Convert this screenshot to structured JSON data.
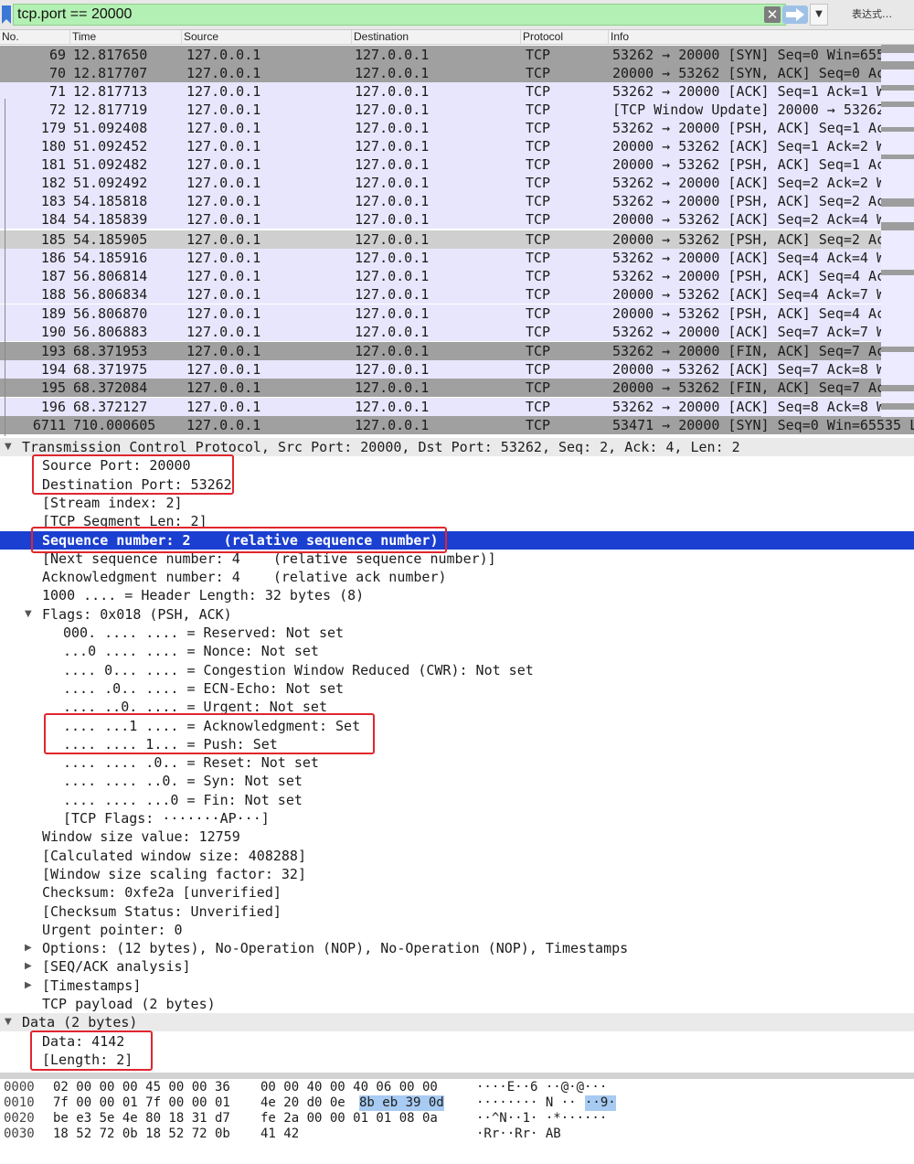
{
  "filter": {
    "value": "tcp.port == 20000",
    "expression_button": "表达式…",
    "input_color": "#b3f0b3"
  },
  "columns": [
    "No.",
    "Time",
    "Source",
    "Destination",
    "Protocol",
    "Info"
  ],
  "packets": [
    {
      "no": "69",
      "time": "12.817650",
      "src": "127.0.0.1",
      "dst": "127.0.0.1",
      "proto": "TCP",
      "info": "53262 → 20000 [SYN] Seq=0 Win=6553",
      "style": "dark"
    },
    {
      "no": "70",
      "time": "12.817707",
      "src": "127.0.0.1",
      "dst": "127.0.0.1",
      "proto": "TCP",
      "info": "20000 → 53262 [SYN, ACK] Seq=0 Ack",
      "style": "dark"
    },
    {
      "no": "71",
      "time": "12.817713",
      "src": "127.0.0.1",
      "dst": "127.0.0.1",
      "proto": "TCP",
      "info": "53262 → 20000 [ACK] Seq=1 Ack=1 Wi",
      "style": "normal"
    },
    {
      "no": "72",
      "time": "12.817719",
      "src": "127.0.0.1",
      "dst": "127.0.0.1",
      "proto": "TCP",
      "info": "[TCP Window Update] 20000 → 53262",
      "style": "normal"
    },
    {
      "no": "179",
      "time": "51.092408",
      "src": "127.0.0.1",
      "dst": "127.0.0.1",
      "proto": "TCP",
      "info": "53262 → 20000 [PSH, ACK] Seq=1 Ack",
      "style": "normal"
    },
    {
      "no": "180",
      "time": "51.092452",
      "src": "127.0.0.1",
      "dst": "127.0.0.1",
      "proto": "TCP",
      "info": "20000 → 53262 [ACK] Seq=1 Ack=2 Wi",
      "style": "normal"
    },
    {
      "no": "181",
      "time": "51.092482",
      "src": "127.0.0.1",
      "dst": "127.0.0.1",
      "proto": "TCP",
      "info": "20000 → 53262 [PSH, ACK] Seq=1 Ack",
      "style": "normal"
    },
    {
      "no": "182",
      "time": "51.092492",
      "src": "127.0.0.1",
      "dst": "127.0.0.1",
      "proto": "TCP",
      "info": "53262 → 20000 [ACK] Seq=2 Ack=2 Wi",
      "style": "normal"
    },
    {
      "no": "183",
      "time": "54.185818",
      "src": "127.0.0.1",
      "dst": "127.0.0.1",
      "proto": "TCP",
      "info": "53262 → 20000 [PSH, ACK] Seq=2 Ack",
      "style": "normal"
    },
    {
      "no": "184",
      "time": "54.185839",
      "src": "127.0.0.1",
      "dst": "127.0.0.1",
      "proto": "TCP",
      "info": "20000 → 53262 [ACK] Seq=2 Ack=4 Wi",
      "style": "normal"
    },
    {
      "no": "185",
      "time": "54.185905",
      "src": "127.0.0.1",
      "dst": "127.0.0.1",
      "proto": "TCP",
      "info": "20000 → 53262 [PSH, ACK] Seq=2 Ack",
      "style": "light"
    },
    {
      "no": "186",
      "time": "54.185916",
      "src": "127.0.0.1",
      "dst": "127.0.0.1",
      "proto": "TCP",
      "info": "53262 → 20000 [ACK] Seq=4 Ack=4 Wi",
      "style": "normal"
    },
    {
      "no": "187",
      "time": "56.806814",
      "src": "127.0.0.1",
      "dst": "127.0.0.1",
      "proto": "TCP",
      "info": "53262 → 20000 [PSH, ACK] Seq=4 Ack",
      "style": "normal"
    },
    {
      "no": "188",
      "time": "56.806834",
      "src": "127.0.0.1",
      "dst": "127.0.0.1",
      "proto": "TCP",
      "info": "20000 → 53262 [ACK] Seq=4 Ack=7 Wi",
      "style": "normal"
    },
    {
      "no": "189",
      "time": "56.806870",
      "src": "127.0.0.1",
      "dst": "127.0.0.1",
      "proto": "TCP",
      "info": "20000 → 53262 [PSH, ACK] Seq=4 Ack",
      "style": "normal"
    },
    {
      "no": "190",
      "time": "56.806883",
      "src": "127.0.0.1",
      "dst": "127.0.0.1",
      "proto": "TCP",
      "info": "53262 → 20000 [ACK] Seq=7 Ack=7 Wi",
      "style": "normal"
    },
    {
      "no": "193",
      "time": "68.371953",
      "src": "127.0.0.1",
      "dst": "127.0.0.1",
      "proto": "TCP",
      "info": "53262 → 20000 [FIN, ACK] Seq=7 Ack",
      "style": "dark"
    },
    {
      "no": "194",
      "time": "68.371975",
      "src": "127.0.0.1",
      "dst": "127.0.0.1",
      "proto": "TCP",
      "info": "20000 → 53262 [ACK] Seq=7 Ack=8 Wi",
      "style": "normal"
    },
    {
      "no": "195",
      "time": "68.372084",
      "src": "127.0.0.1",
      "dst": "127.0.0.1",
      "proto": "TCP",
      "info": "20000 → 53262 [FIN, ACK] Seq=7 Ack",
      "style": "dark"
    },
    {
      "no": "196",
      "time": "68.372127",
      "src": "127.0.0.1",
      "dst": "127.0.0.1",
      "proto": "TCP",
      "info": "53262 → 20000 [ACK] Seq=8 Ack=8 Wi",
      "style": "normal"
    },
    {
      "no": "6711",
      "time": "710.000605",
      "src": "127.0.0.1",
      "dst": "127.0.0.1",
      "proto": "TCP",
      "info": "53471 → 20000 [SYN] Seq=0 Win=65535 Le",
      "style": "dark"
    }
  ],
  "details": [
    {
      "indent": 0,
      "toggle": "open",
      "text": "Transmission Control Protocol, Src Port: 20000, Dst Port: 53262, Seq: 2, Ack: 4, Len: 2",
      "style": "hdr"
    },
    {
      "indent": 1,
      "toggle": "",
      "text": "Source Port: 20000"
    },
    {
      "indent": 1,
      "toggle": "",
      "text": "Destination Port: 53262"
    },
    {
      "indent": 1,
      "toggle": "",
      "text": "[Stream index: 2]"
    },
    {
      "indent": 1,
      "toggle": "",
      "text": "[TCP Segment Len: 2]"
    },
    {
      "indent": 1,
      "toggle": "",
      "text": "Sequence number: 2    (relative sequence number)",
      "style": "sel"
    },
    {
      "indent": 1,
      "toggle": "",
      "text": "[Next sequence number: 4    (relative sequence number)]"
    },
    {
      "indent": 1,
      "toggle": "",
      "text": "Acknowledgment number: 4    (relative ack number)"
    },
    {
      "indent": 1,
      "toggle": "",
      "text": "1000 .... = Header Length: 32 bytes (8)"
    },
    {
      "indent": 1,
      "toggle": "open",
      "text": "Flags: 0x018 (PSH, ACK)"
    },
    {
      "indent": 2,
      "toggle": "",
      "text": "000. .... .... = Reserved: Not set"
    },
    {
      "indent": 2,
      "toggle": "",
      "text": "...0 .... .... = Nonce: Not set"
    },
    {
      "indent": 2,
      "toggle": "",
      "text": ".... 0... .... = Congestion Window Reduced (CWR): Not set"
    },
    {
      "indent": 2,
      "toggle": "",
      "text": ".... .0.. .... = ECN-Echo: Not set"
    },
    {
      "indent": 2,
      "toggle": "",
      "text": ".... ..0. .... = Urgent: Not set"
    },
    {
      "indent": 2,
      "toggle": "",
      "text": ".... ...1 .... = Acknowledgment: Set"
    },
    {
      "indent": 2,
      "toggle": "",
      "text": ".... .... 1... = Push: Set"
    },
    {
      "indent": 2,
      "toggle": "",
      "text": ".... .... .0.. = Reset: Not set"
    },
    {
      "indent": 2,
      "toggle": "",
      "text": ".... .... ..0. = Syn: Not set"
    },
    {
      "indent": 2,
      "toggle": "",
      "text": ".... .... ...0 = Fin: Not set"
    },
    {
      "indent": 2,
      "toggle": "",
      "text": "[TCP Flags: ·······AP···]"
    },
    {
      "indent": 1,
      "toggle": "",
      "text": "Window size value: 12759"
    },
    {
      "indent": 1,
      "toggle": "",
      "text": "[Calculated window size: 408288]"
    },
    {
      "indent": 1,
      "toggle": "",
      "text": "[Window size scaling factor: 32]"
    },
    {
      "indent": 1,
      "toggle": "",
      "text": "Checksum: 0xfe2a [unverified]"
    },
    {
      "indent": 1,
      "toggle": "",
      "text": "[Checksum Status: Unverified]"
    },
    {
      "indent": 1,
      "toggle": "",
      "text": "Urgent pointer: 0"
    },
    {
      "indent": 1,
      "toggle": "closed",
      "text": "Options: (12 bytes), No-Operation (NOP), No-Operation (NOP), Timestamps"
    },
    {
      "indent": 1,
      "toggle": "closed",
      "text": "[SEQ/ACK analysis]"
    },
    {
      "indent": 1,
      "toggle": "closed",
      "text": "[Timestamps]"
    },
    {
      "indent": 1,
      "toggle": "",
      "text": "TCP payload (2 bytes)"
    },
    {
      "indent": 0,
      "toggle": "open",
      "text": "Data (2 bytes)",
      "style": "hdr"
    },
    {
      "indent": 1,
      "toggle": "",
      "text": "Data: 4142"
    },
    {
      "indent": 1,
      "toggle": "",
      "text": "[Length: 2]"
    }
  ],
  "hex": [
    {
      "offset": "0000",
      "bytes_a": "02 00 00 00 45 00 00 36",
      "bytes_b": "00 00 40 00 40 06 00 00",
      "bytes_hl": "",
      "ascii": "····E··6 ··@·@···",
      "ascii_hl": ""
    },
    {
      "offset": "0010",
      "bytes_a": "7f 00 00 01 7f 00 00 01",
      "bytes_b": "4e 20 d0 0e",
      "bytes_hl": "8b eb 39 0d",
      "ascii": "········ N ··",
      "ascii_hl": "··9·"
    },
    {
      "offset": "0020",
      "bytes_a": "be e3 5e 4e 80 18 31 d7",
      "bytes_b": "fe 2a 00 00 01 01 08 0a",
      "bytes_hl": "",
      "ascii": "··^N··1· ·*······",
      "ascii_hl": ""
    },
    {
      "offset": "0030",
      "bytes_a": "18 52 72 0b 18 52 72 0b",
      "bytes_b": "41 42",
      "bytes_hl": "",
      "ascii": "·Rr··Rr· AB",
      "ascii_hl": ""
    }
  ],
  "colors": {
    "row_normal": "#e8e6fc",
    "row_dark": "#a0a0a0",
    "row_light": "#cfcfcf",
    "selection": "#1b3fd1",
    "annotation_box": "#e0262e",
    "hex_highlight": "#a7cbf2"
  }
}
